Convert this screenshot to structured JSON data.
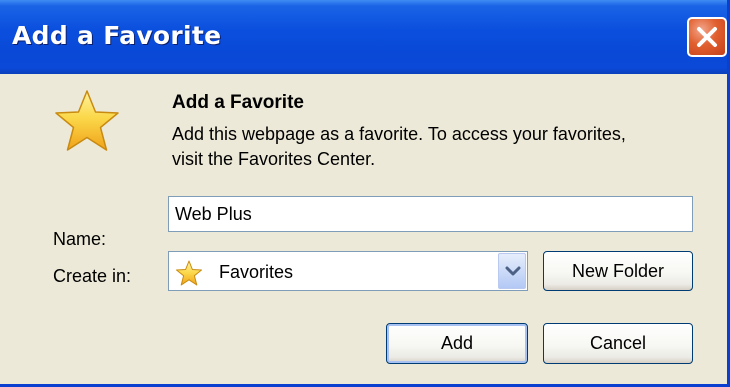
{
  "window": {
    "title": "Add a Favorite"
  },
  "dialog": {
    "heading": "Add a Favorite",
    "description": "Add this webpage as a favorite. To access your favorites, visit the Favorites Center.",
    "name_label": "Name:",
    "name_value": "Web Plus",
    "create_in_label": "Create in:",
    "create_in_value": "Favorites",
    "new_folder_label": "New Folder",
    "add_label": "Add",
    "cancel_label": "Cancel"
  },
  "icons": {
    "large": "star-icon",
    "combo": "star-icon",
    "dropdown": "chevron-down-icon",
    "close": "close-icon"
  },
  "colors": {
    "titlebar": "#0a48d6",
    "dialog_bg": "#ece9d8",
    "close_button": "#e1602f",
    "star": "#f7c72d"
  }
}
